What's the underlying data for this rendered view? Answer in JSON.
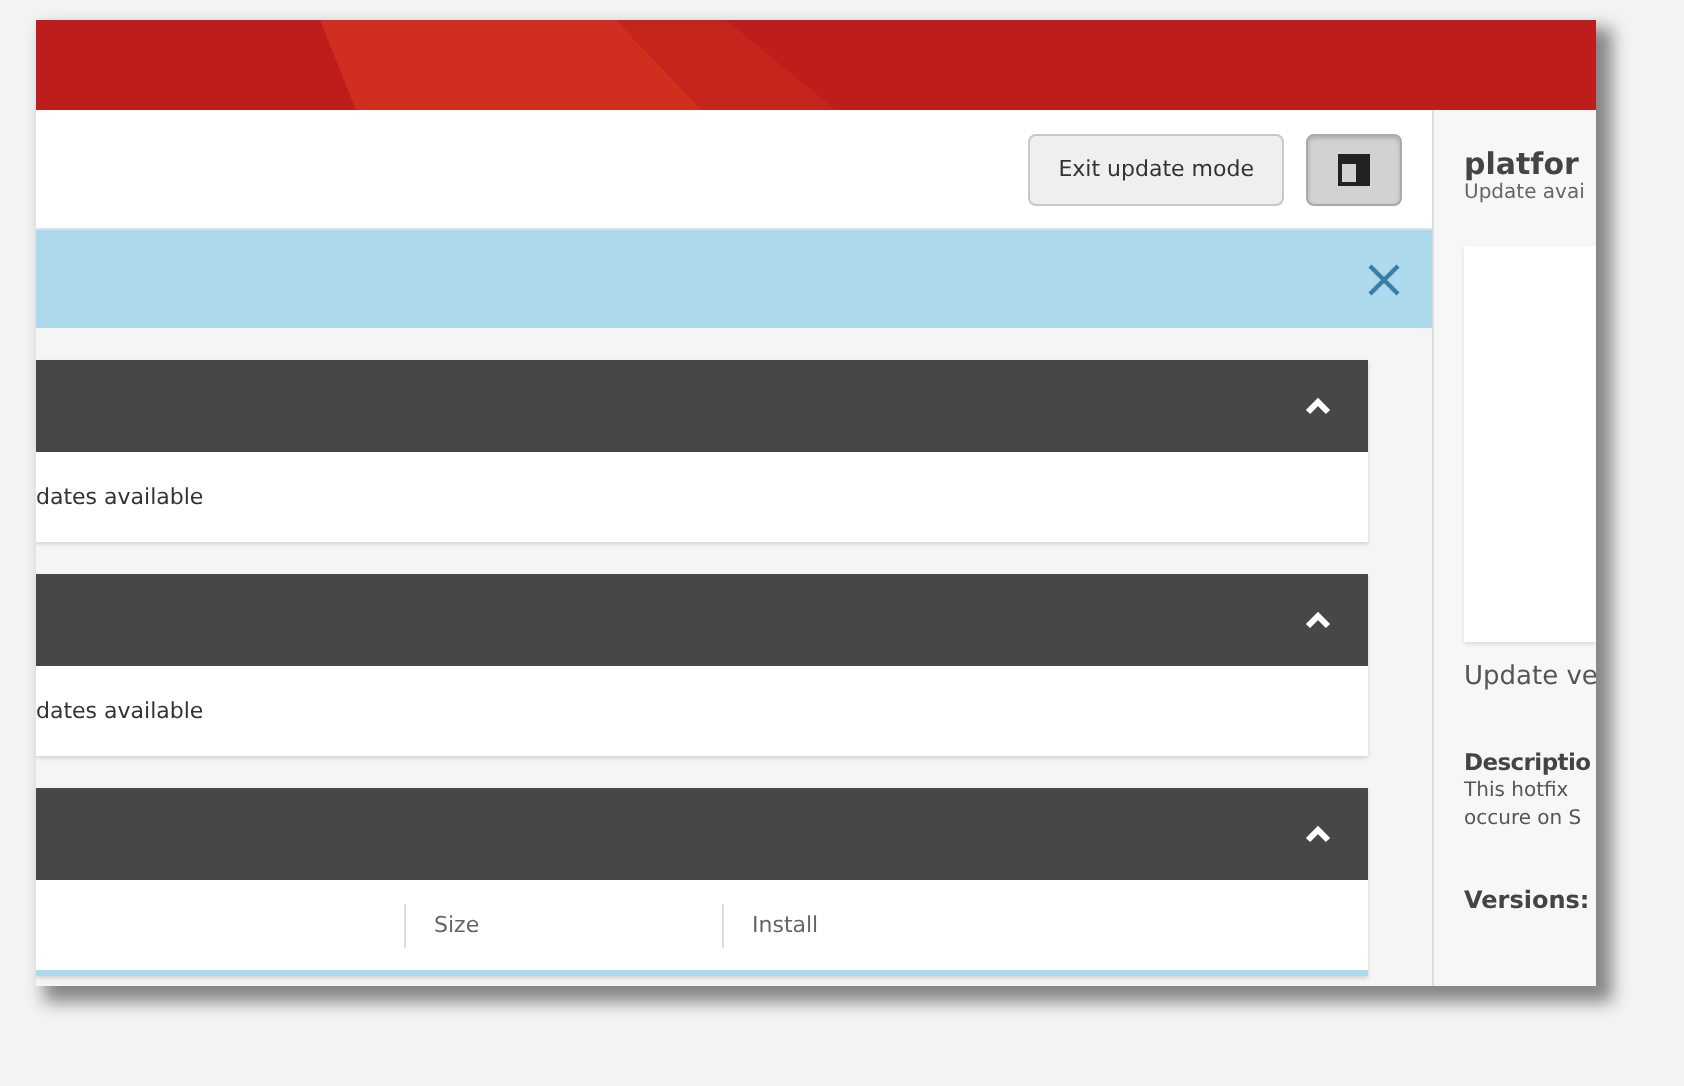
{
  "toolbar": {
    "buttons": [
      {
        "kind": "text",
        "label": "Exit update mode",
        "selected": false
      },
      {
        "kind": "layout",
        "selected": true
      }
    ]
  },
  "info_bar": {
    "closable": true
  },
  "cards": [
    {
      "kind": "status",
      "expanded": true,
      "status": "dates available"
    },
    {
      "kind": "status",
      "expanded": true,
      "status": "dates available"
    },
    {
      "kind": "table",
      "expanded": true,
      "columns": [
        "Size",
        "Install"
      ]
    }
  ],
  "side_panel": {
    "title": "platfor",
    "subtitle": "Update avai",
    "update_version_label": "Update ve",
    "description_heading": "Descriptio",
    "description_lines": [
      "This hotfix",
      "occure on S"
    ],
    "versions_heading": "Versions:"
  }
}
